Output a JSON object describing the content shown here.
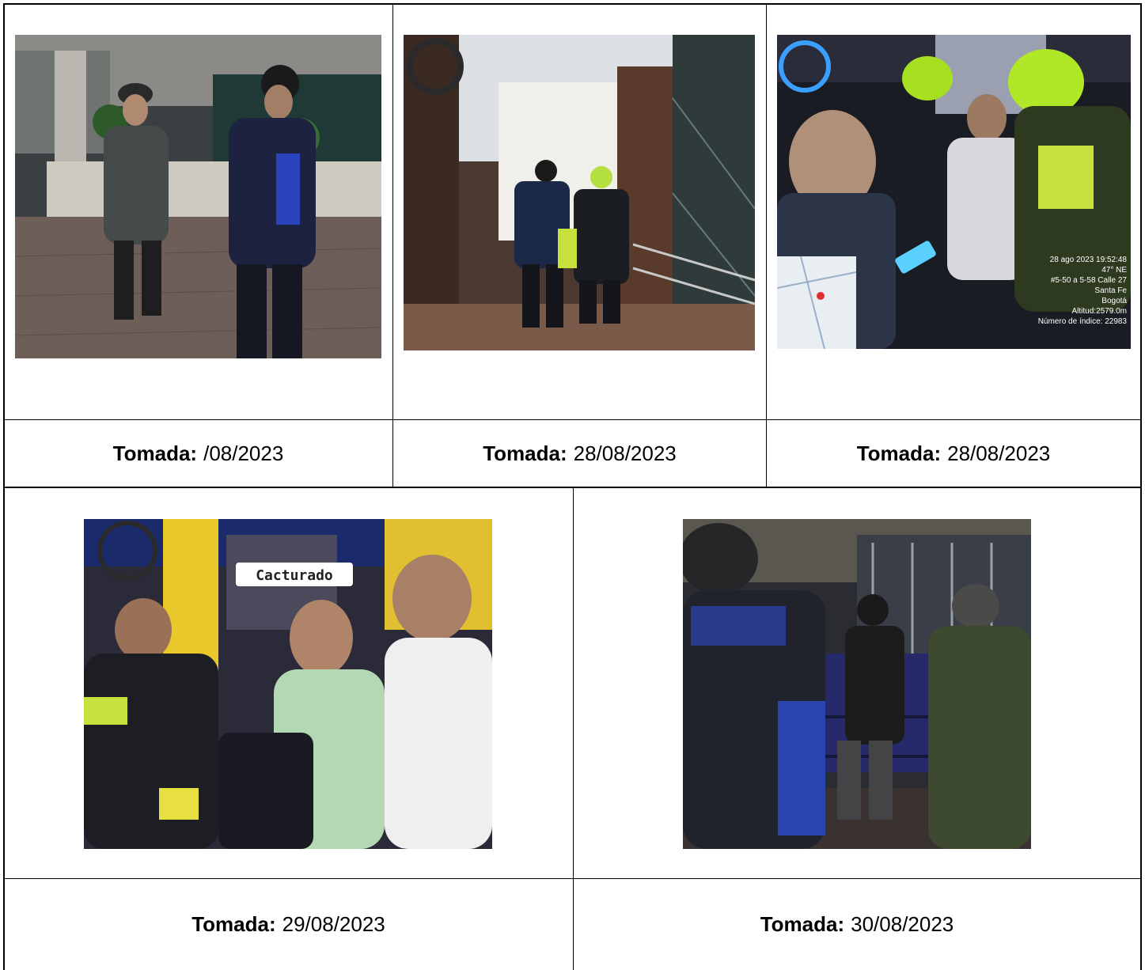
{
  "row1": {
    "photos": [
      {
        "alt": "photo-1"
      },
      {
        "alt": "photo-2"
      },
      {
        "alt": "photo-3",
        "overlay": [
          "28 ago 2023 19:52:48",
          "47° NE",
          "#5-50 a 5-58 Calle 27",
          "Santa Fe",
          "Bogotá",
          "Altitud:2579.0m",
          "Número de índice: 22983"
        ]
      }
    ],
    "captions": [
      {
        "label": "Tomada:",
        "value": "/08/2023"
      },
      {
        "label": "Tomada:",
        "value": "28/08/2023"
      },
      {
        "label": "Tomada:",
        "value": "28/08/2023"
      }
    ]
  },
  "row2": {
    "photos": [
      {
        "alt": "photo-4",
        "badge": "Cacturado"
      },
      {
        "alt": "photo-5"
      }
    ],
    "captions": [
      {
        "label": "Tomada:",
        "value": "29/08/2023"
      },
      {
        "label": "Tomada:",
        "value": "30/08/2023"
      }
    ]
  }
}
